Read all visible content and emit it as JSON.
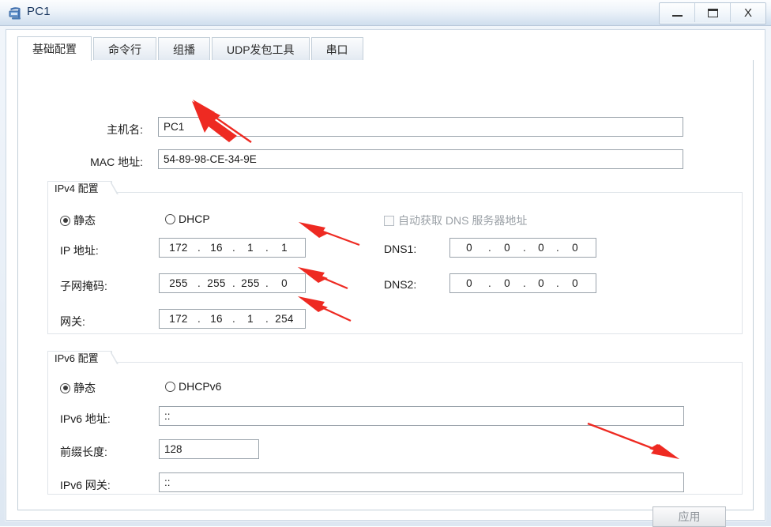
{
  "window": {
    "title": "PC1",
    "icon": "pc-device-icon",
    "controls": {
      "minimize": "minimize-icon",
      "maximize": "maximize-icon",
      "close": "X"
    }
  },
  "tabs": [
    {
      "label": "基础配置",
      "active": true
    },
    {
      "label": "命令行",
      "active": false
    },
    {
      "label": "组播",
      "active": false
    },
    {
      "label": "UDP发包工具",
      "active": false
    },
    {
      "label": "串口",
      "active": false
    }
  ],
  "basic": {
    "hostname_label": "主机名:",
    "hostname_value": "PC1",
    "mac_label": "MAC 地址:",
    "mac_value": "54-89-98-CE-34-9E"
  },
  "ipv4": {
    "group_title": "IPv4 配置",
    "mode_static": "静态",
    "mode_dhcp": "DHCP",
    "mode_selected": "静态",
    "ip_label": "IP 地址:",
    "ip_octets": [
      "172",
      "16",
      "1",
      "1"
    ],
    "mask_label": "子网掩码:",
    "mask_octets": [
      "255",
      "255",
      "255",
      "0"
    ],
    "gateway_label": "网关:",
    "gateway_octets": [
      "172",
      "16",
      "1",
      "254"
    ],
    "dns_auto_label": "自动获取 DNS 服务器地址",
    "dns_auto_checked": false,
    "dns1_label": "DNS1:",
    "dns1_octets": [
      "0",
      "0",
      "0",
      "0"
    ],
    "dns2_label": "DNS2:",
    "dns2_octets": [
      "0",
      "0",
      "0",
      "0"
    ]
  },
  "ipv6": {
    "group_title": "IPv6 配置",
    "mode_static": "静态",
    "mode_dhcp": "DHCPv6",
    "mode_selected": "静态",
    "addr_label": "IPv6 地址:",
    "addr_value": "::",
    "prefix_label": "前缀长度:",
    "prefix_value": "128",
    "gateway_label": "IPv6 网关:",
    "gateway_value": "::"
  },
  "footer": {
    "apply_label": "应用",
    "apply_enabled": false
  },
  "annotations": {
    "color": "#ee2a22",
    "count": 5,
    "targets": [
      "hostname-field",
      "ipv4-ip-field",
      "ipv4-mask-field",
      "ipv4-gateway-field",
      "ipv6-gateway-field"
    ]
  },
  "colors": {
    "title_text": "#15335c",
    "arrow_red": "#ee2a22",
    "frame": "#ccd8e4",
    "field_border": "#9aa3ab"
  }
}
